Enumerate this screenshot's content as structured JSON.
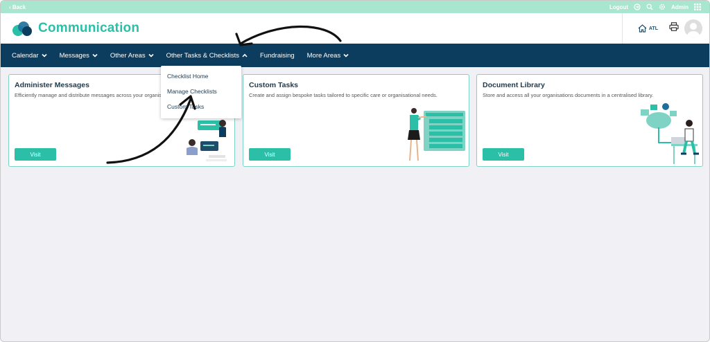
{
  "topbar": {
    "back_label": "‹ Back",
    "logout_label": "Logout",
    "user_label": "Admin",
    "icons": [
      "logout-icon",
      "search-icon",
      "gear-icon",
      "apps-grid-icon"
    ]
  },
  "header": {
    "title": "Communication",
    "location_label": "ATL"
  },
  "nav": {
    "items": [
      {
        "label": "Calendar",
        "chevron": "down"
      },
      {
        "label": "Messages",
        "chevron": "down"
      },
      {
        "label": "Other Areas",
        "chevron": "down"
      },
      {
        "label": "Other Tasks & Checklists",
        "chevron": "up"
      },
      {
        "label": "Fundraising",
        "chevron": "none"
      },
      {
        "label": "More Areas",
        "chevron": "down"
      }
    ]
  },
  "dropdown": {
    "items": [
      {
        "label": "Checklist Home"
      },
      {
        "label": "Manage Checklists"
      },
      {
        "label": "Custom Tasks"
      }
    ]
  },
  "cards": [
    {
      "title": "Administer Messages",
      "description": "Efficiently manage and distribute messages across your organisation.",
      "button_label": "Visit"
    },
    {
      "title": "Custom Tasks",
      "description": "Create and assign bespoke tasks tailored to specific care or organisational needs.",
      "button_label": "Visit"
    },
    {
      "title": "Document Library",
      "description": "Store and access all your organisations documents in a centralised library.",
      "button_label": "Visit"
    }
  ],
  "colors": {
    "accent": "#2bbfa8",
    "nav_bg": "#0d3d5e",
    "topbar_bg": "#a9e6cf",
    "page_bg": "#f0f0f5"
  }
}
